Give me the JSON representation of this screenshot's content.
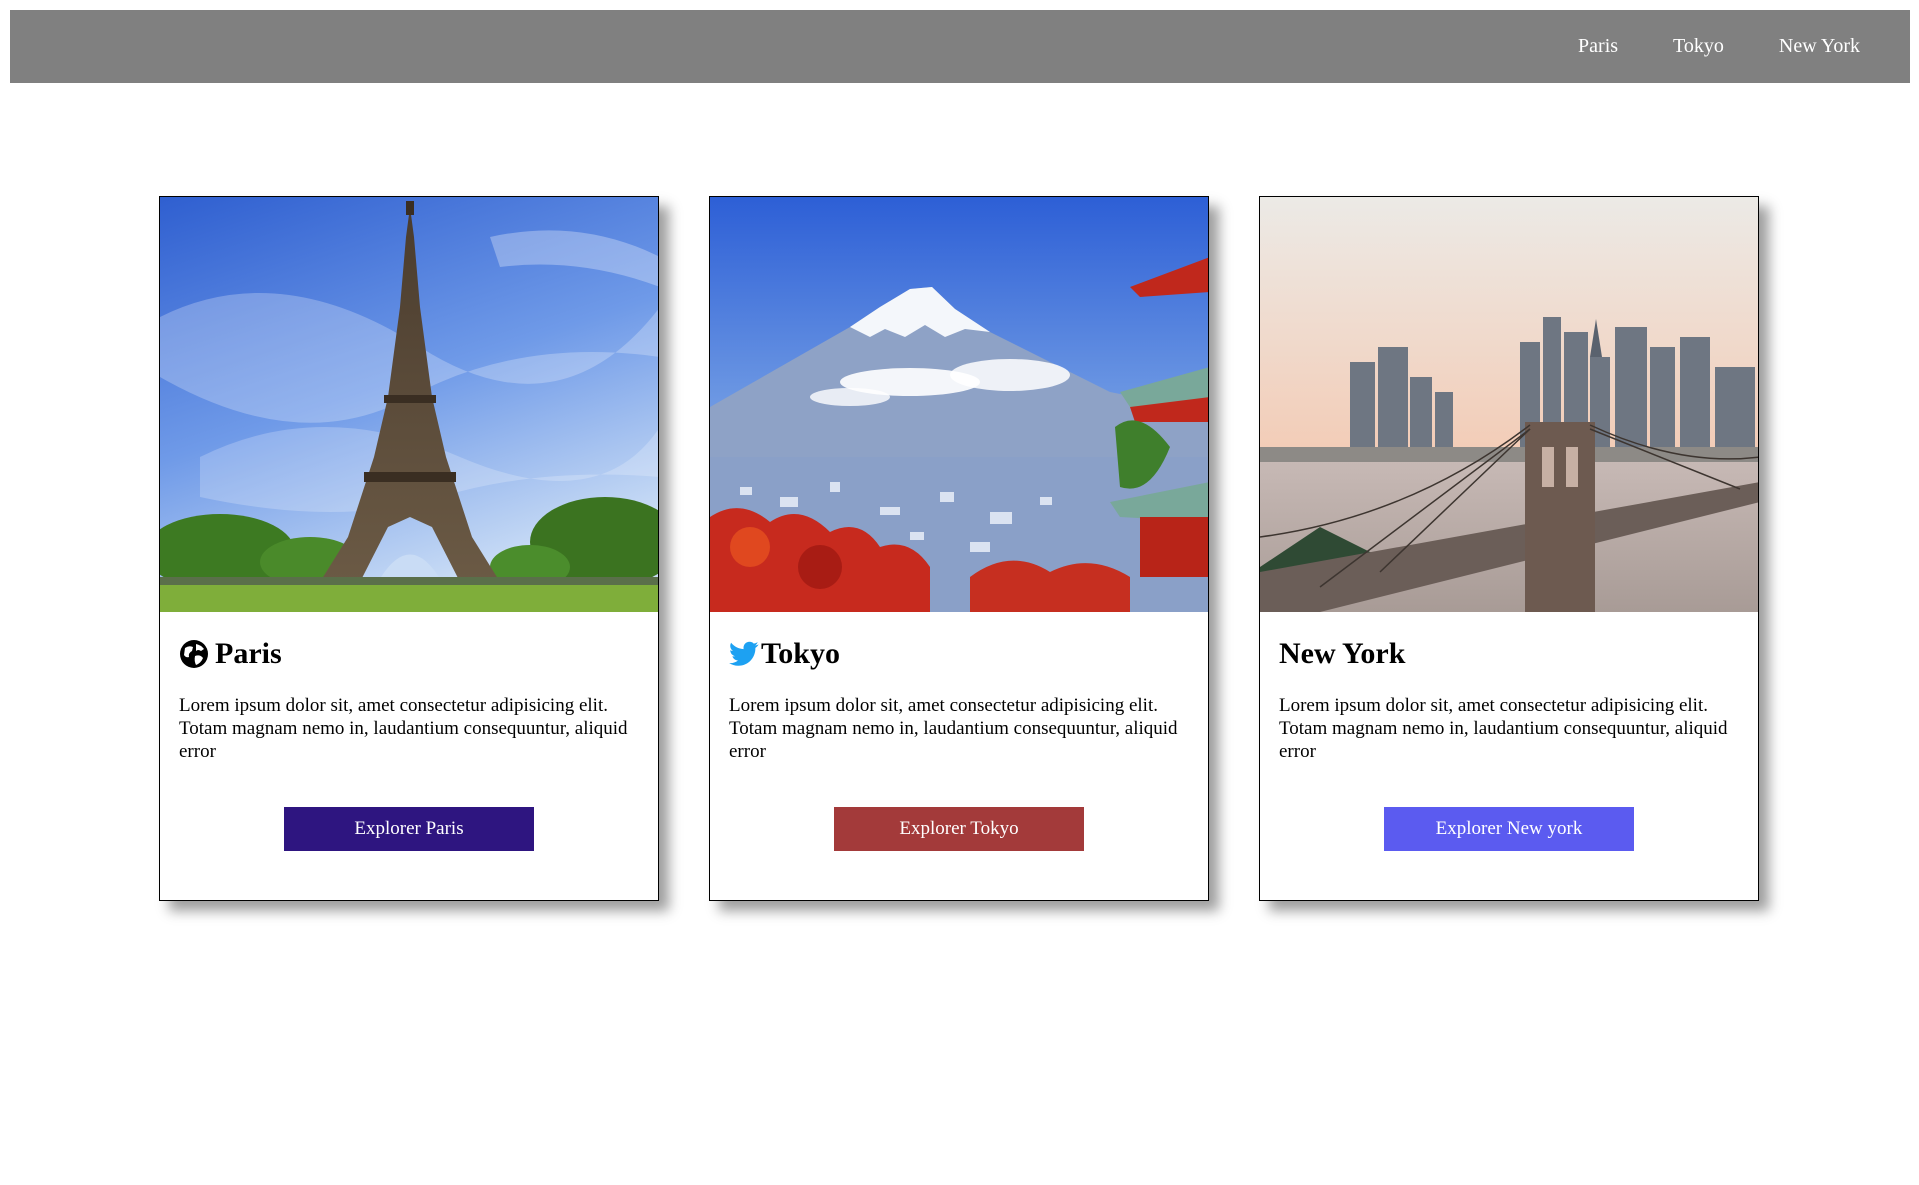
{
  "nav": {
    "items": [
      "Paris",
      "Tokyo",
      "New York"
    ],
    "background": "#808080"
  },
  "cards": [
    {
      "title": "Paris",
      "icon": "globe-icon",
      "text": "Lorem ipsum dolor sit, amet consectetur adipisicing elit. Totam magnam nemo in, laudantium consequuntur, aliquid error",
      "button_label": "Explorer Paris",
      "button_color": "#2e1580"
    },
    {
      "title": "Tokyo",
      "icon": "twitter-bird-icon",
      "text": "Lorem ipsum dolor sit, amet consectetur adipisicing elit. Totam magnam nemo in, laudantium consequuntur, aliquid error",
      "button_label": "Explorer Tokyo",
      "button_color": "#a33a3a"
    },
    {
      "title": "New York",
      "icon": "",
      "text": "Lorem ipsum dolor sit, amet consectetur adipisicing elit. Totam magnam nemo in, laudantium consequuntur, aliquid error",
      "button_label": "Explorer New york",
      "button_color": "#5b5bf0"
    }
  ]
}
